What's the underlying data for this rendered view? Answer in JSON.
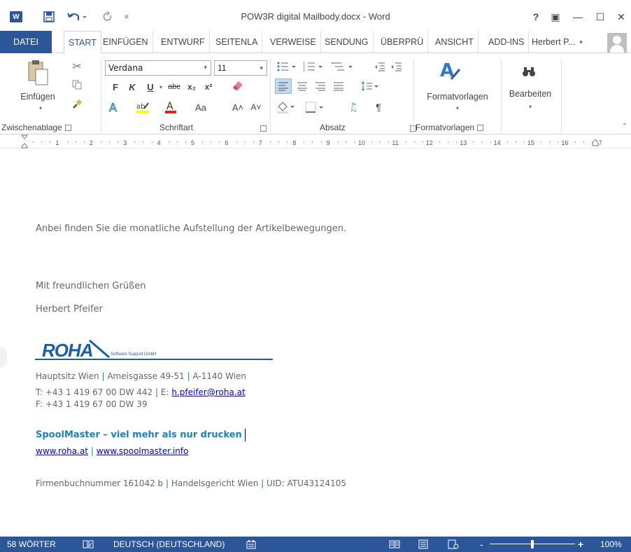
{
  "titlebar": {
    "app_logo": "W",
    "doc_title": "POW3R digital Mailbody.docx - Word",
    "help": "?",
    "ribbon_display": "▣",
    "minimize": "—",
    "maximize": "☐",
    "close": "✕",
    "qa_more": "≡"
  },
  "tabs": {
    "file": "DATEI",
    "items": [
      "START",
      "EINFÜGEN",
      "ENTWURF",
      "SEITENLA",
      "VERWEISE",
      "SENDUNG",
      "ÜBERPRÜ",
      "ANSICHT",
      "ADD-INS"
    ],
    "user": "Herbert P..."
  },
  "ribbon": {
    "clipboard": {
      "paste": "Einfügen",
      "label": "Zwischenablage"
    },
    "font": {
      "name": "Verdana",
      "size": "11",
      "bold": "F",
      "italic": "K",
      "underline": "U",
      "strike": "abc",
      "subscript": "x₂",
      "superscript": "x²",
      "case": "Aa",
      "grow": "A˄",
      "shrink": "A˅",
      "label": "Schriftart"
    },
    "paragraph": {
      "sort": "A↓Z",
      "pilcrow": "¶",
      "label": "Absatz"
    },
    "styles": {
      "button": "Formatvorlagen",
      "label": "Formatvorlagen"
    },
    "editing": {
      "button": "Bearbeiten"
    }
  },
  "ruler": {
    "numbers": [
      "1",
      "2",
      "3",
      "4",
      "5",
      "6",
      "7",
      "8",
      "9",
      "10",
      "11",
      "12",
      "13",
      "14",
      "15",
      "16",
      "17"
    ]
  },
  "document": {
    "line1": "Anbei finden Sie die monatliche Aufstellung der Artikelbewegungen.",
    "greeting": "Mit freundlichen Grüßen",
    "name": "Herbert Pfeifer",
    "logo_main": "ROHA",
    "logo_sub": "Software Support GmbH",
    "addr_a": "Hauptsitz Wien",
    "addr_b": "Ameisgasse 49-51",
    "addr_c": "A-1140 Wien",
    "phone": "T: +43 1 419 67 00 DW 442",
    "email_label": "E:",
    "email": "h.pfeifer@roha.at",
    "fax": "F: +43 1 419 67 00 DW 39",
    "slogan": "SpoolMaster – viel mehr als nur drucken",
    "web1": "www.roha.at",
    "web2": "www.spoolmaster.info",
    "reg_a": "Firmenbuchnummer 161042 b",
    "reg_b": "Handelsgericht Wien",
    "reg_c": "UID: ATU43124105",
    "sep": "|"
  },
  "status": {
    "words": "58 WÖRTER",
    "language": "DEUTSCH (DEUTSCHLAND)",
    "zoom_minus": "-",
    "zoom_plus": "+",
    "zoom": "100%"
  },
  "colors": {
    "brand": "#2b579a",
    "link": "#0000ee",
    "accent_blue": "#1b81c4"
  }
}
